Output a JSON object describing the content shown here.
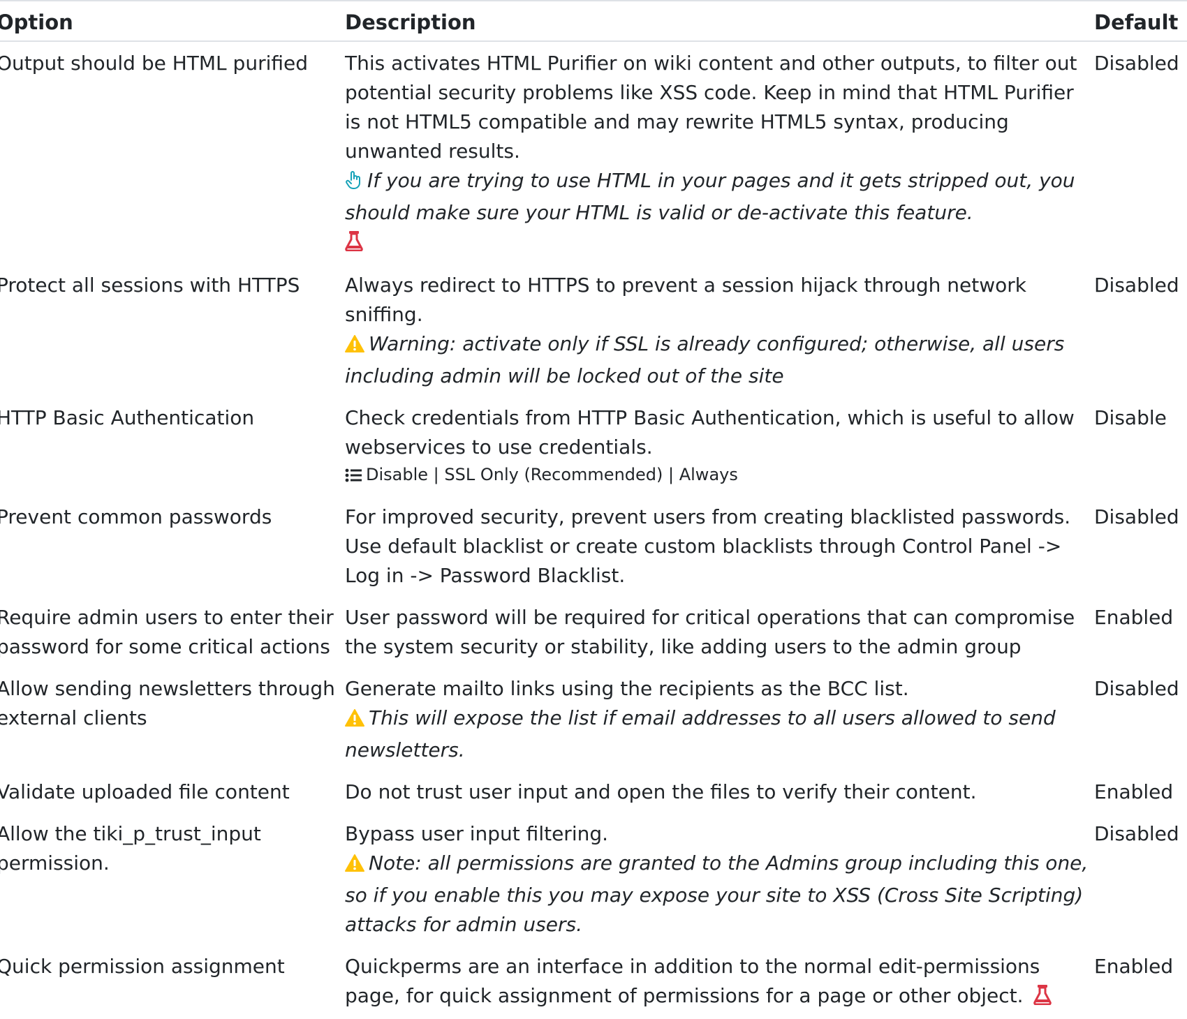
{
  "columns": {
    "option": "Option",
    "description": "Description",
    "default": "Default"
  },
  "rows": [
    {
      "option": "Output should be HTML purified",
      "description": "This activates HTML Purifier on wiki content and other outputs, to filter out potential security problems like XSS code. Keep in mind that HTML Purifier is not HTML5 compatible and may rewrite HTML5 syntax, producing unwanted results.",
      "tip": "If you are trying to use HTML in your pages and it gets stripped out, you should make sure your HTML is valid or de-activate this feature.",
      "tip_icon": "pointing-hand-icon",
      "experimental_icon": "flask-icon",
      "default": "Disabled"
    },
    {
      "option": "Protect all sessions with HTTPS",
      "description": "Always redirect to HTTPS to prevent a session hijack through network sniffing.",
      "warning": "Warning: activate only if SSL is already configured; otherwise, all users including admin will be locked out of the site",
      "warning_icon": "warning-icon",
      "default": "Disabled"
    },
    {
      "option": "HTTP Basic Authentication",
      "description": "Check credentials from HTTP Basic Authentication, which is useful to allow webservices to use credentials.",
      "options_text": "Disable | SSL Only (Recommended) | Always",
      "options_icon": "list-icon",
      "default": "Disable"
    },
    {
      "option": "Prevent common passwords",
      "description": "For improved security, prevent users from creating blacklisted passwords. Use default blacklist or create custom blacklists through Control Panel -> Log in -> Password Blacklist.",
      "default": "Disabled"
    },
    {
      "option": "Require admin users to enter their password for some critical actions",
      "description": "User password will be required for critical operations that can compromise the system security or stability, like adding users to the admin group",
      "default": "Enabled"
    },
    {
      "option": "Allow sending newsletters through external clients",
      "description": "Generate mailto links using the recipients as the BCC list.",
      "warning": "This will expose the list if email addresses to all users allowed to send newsletters.",
      "warning_icon": "warning-icon",
      "default": "Disabled"
    },
    {
      "option": "Validate uploaded file content",
      "description": "Do not trust user input and open the files to verify their content.",
      "default": "Enabled"
    },
    {
      "option": "Allow the tiki_p_trust_input permission.",
      "description": "Bypass user input filtering.",
      "warning": "Note: all permissions are granted to the Admins group including this one, so if you enable this you may expose your site to XSS (Cross Site Scripting) attacks for admin users.",
      "warning_icon": "warning-icon",
      "default": "Disabled"
    },
    {
      "option": "Quick permission assignment",
      "description": "Quickperms are an interface in addition to the normal edit-permissions page, for quick assignment of permissions for a page or other object.",
      "experimental_icon": "flask-icon",
      "default": "Enabled"
    }
  ],
  "colors": {
    "text": "#212529",
    "rule": "#dee2e6",
    "tip_icon": "#17a2b8",
    "warning_icon": "#ffc107",
    "flask_icon": "#dc3545"
  }
}
